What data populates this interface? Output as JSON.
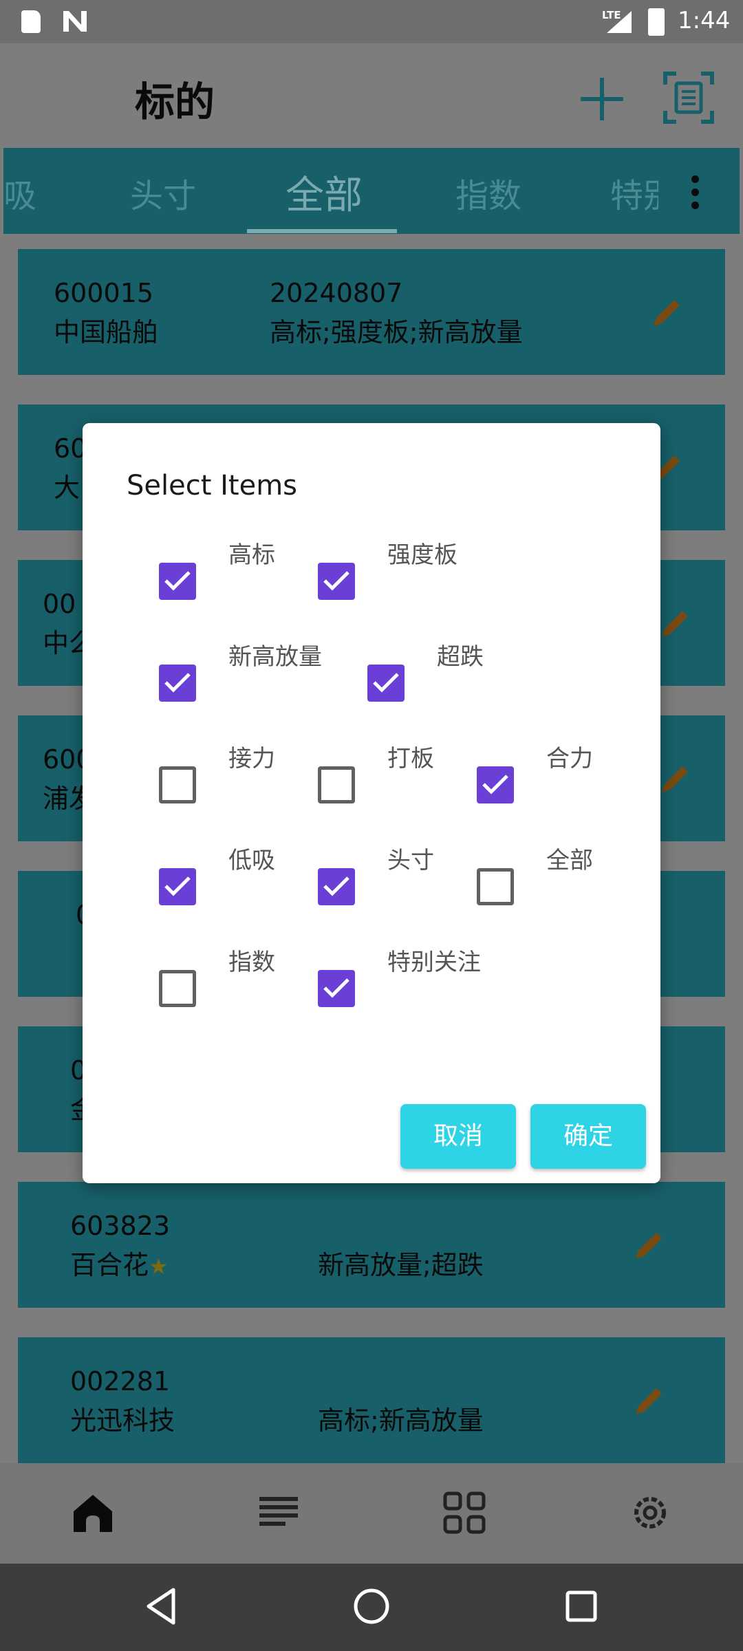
{
  "status_bar": {
    "network": "LTE",
    "time": "1:44"
  },
  "app_bar": {
    "title": "标的"
  },
  "tabs": [
    {
      "label": "吸"
    },
    {
      "label": "头寸"
    },
    {
      "label": "全部",
      "active": true
    },
    {
      "label": "指数"
    },
    {
      "label": "特别"
    }
  ],
  "list": [
    {
      "code": "600015",
      "name": "中国船舶",
      "date": "20240807",
      "tags": "高标;强度板;新高放量"
    },
    {
      "code": "60",
      "name": "大"
    },
    {
      "code": "00",
      "name": "中么"
    },
    {
      "code": "600",
      "name": "浦发"
    },
    {
      "code": "0",
      "name": ""
    },
    {
      "code": "0",
      "name": "金"
    },
    {
      "code": "603823",
      "name": "百合花",
      "starred": true,
      "tags": "新高放量;超跌"
    },
    {
      "code": "002281",
      "name": "光迅科技",
      "tags": "高标;新高放量"
    }
  ],
  "dialog": {
    "title": "Select Items",
    "options": [
      {
        "label": "高标",
        "checked": true
      },
      {
        "label": "强度板",
        "checked": true
      },
      {
        "label": "新高放量",
        "checked": true
      },
      {
        "label": "超跌",
        "checked": true
      },
      {
        "label": "接力",
        "checked": false
      },
      {
        "label": "打板",
        "checked": false
      },
      {
        "label": "合力",
        "checked": true
      },
      {
        "label": "低吸",
        "checked": true
      },
      {
        "label": "头寸",
        "checked": true
      },
      {
        "label": "全部",
        "checked": false
      },
      {
        "label": "指数",
        "checked": false
      },
      {
        "label": "特别关注",
        "checked": true
      }
    ],
    "cancel_label": "取消",
    "confirm_label": "确定"
  },
  "bottom_nav": [
    {
      "icon": "home-icon",
      "active": true
    },
    {
      "icon": "list-icon"
    },
    {
      "icon": "grid-icon"
    },
    {
      "icon": "settings-icon"
    }
  ],
  "colors": {
    "accent": "#2ed3e6",
    "checkbox": "#6a3fd6",
    "card": "#175f69"
  }
}
